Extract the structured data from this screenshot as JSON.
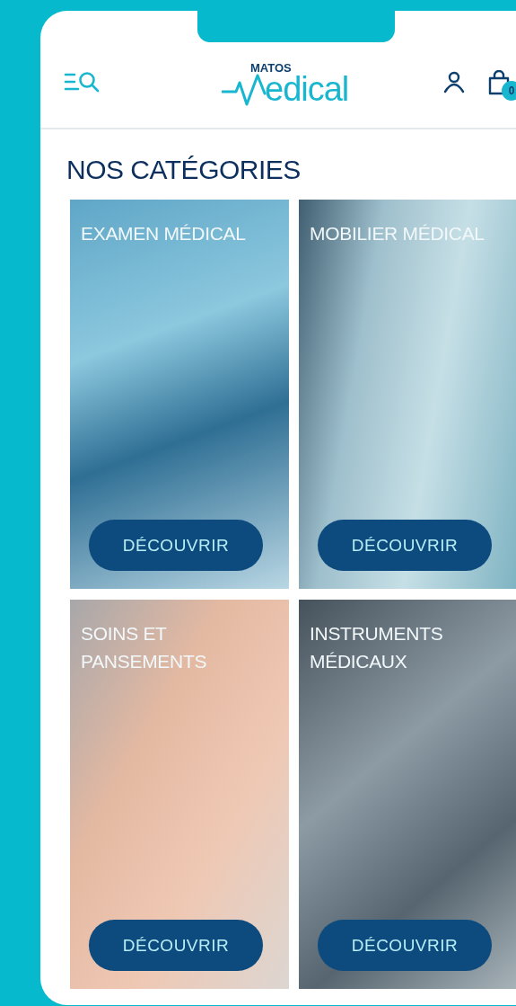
{
  "header": {
    "logo": {
      "top": "MATOS",
      "word": "edical"
    },
    "cart": {
      "count": "0"
    }
  },
  "section": {
    "title": "NOS CATÉGORIES"
  },
  "categories": [
    {
      "title": "EXAMEN MÉDICAL",
      "button": "DÉCOUVRIR"
    },
    {
      "title": "MOBILIER MÉDICAL",
      "button": "DÉCOUVRIR"
    },
    {
      "title": "SOINS ET PANSEMENTS",
      "button": "DÉCOUVRIR"
    },
    {
      "title": "INSTRUMENTS MÉDICAUX",
      "button": "DÉCOUVRIR"
    }
  ]
}
